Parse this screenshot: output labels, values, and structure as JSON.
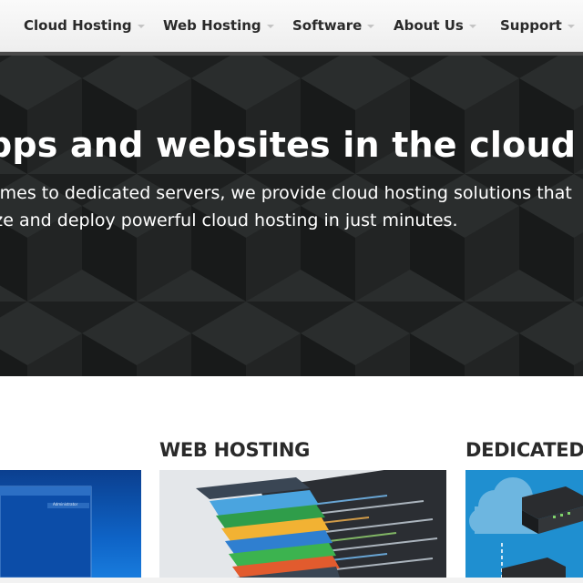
{
  "nav": {
    "items": [
      {
        "label": "Cloud Hosting"
      },
      {
        "label": "Web Hosting"
      },
      {
        "label": "Software"
      },
      {
        "label": "About Us"
      },
      {
        "label": "Support"
      }
    ]
  },
  "hero": {
    "title": "pps and websites in the cloud",
    "line1": "ames to dedicated servers, we provide cloud hosting solutions that",
    "line2": "ize and deploy powerful cloud hosting in just minutes."
  },
  "products": {
    "web_hosting": {
      "title": "WEB HOSTING"
    },
    "dedicated": {
      "title": "DEDICATED S"
    },
    "windows_user": "Administrator"
  },
  "colors": {
    "hero_bg": "#1f2121",
    "nav_text": "#2a2a2a",
    "accent_blue": "#1f8fd0"
  }
}
